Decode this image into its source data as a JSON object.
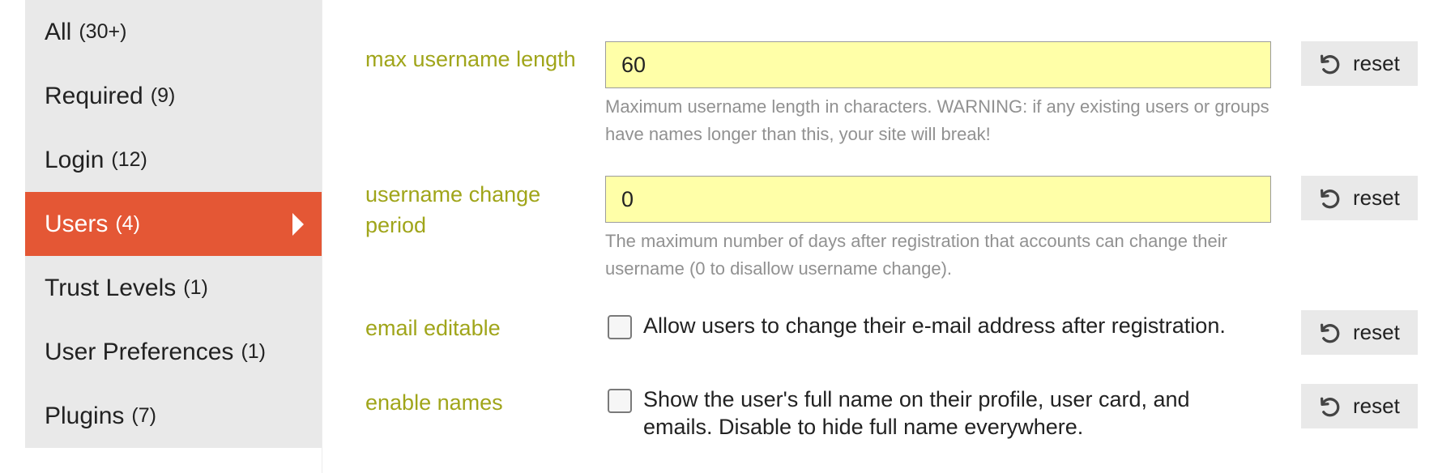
{
  "sidebar": {
    "items": [
      {
        "label": "All",
        "count": "(30+)"
      },
      {
        "label": "Required",
        "count": "(9)"
      },
      {
        "label": "Login",
        "count": "(12)"
      },
      {
        "label": "Users",
        "count": "(4)",
        "active": true
      },
      {
        "label": "Trust Levels",
        "count": "(1)"
      },
      {
        "label": "User Preferences",
        "count": "(1)"
      },
      {
        "label": "Plugins",
        "count": "(7)"
      }
    ]
  },
  "settings": [
    {
      "label": "max username length",
      "type": "text",
      "value": "60",
      "description": "Maximum username length in characters. WARNING: if any existing users or groups have names longer than this, your site will break!",
      "reset_label": "reset"
    },
    {
      "label": "username change period",
      "type": "text",
      "value": "0",
      "description": "The maximum number of days after registration that accounts can change their username (0 to disallow username change).",
      "reset_label": "reset"
    },
    {
      "label": "email editable",
      "type": "checkbox",
      "checked": false,
      "checkbox_text": "Allow users to change their e-mail address after registration.",
      "reset_label": "reset"
    },
    {
      "label": "enable names",
      "type": "checkbox",
      "checked": false,
      "checkbox_text": "Show the user's full name on their profile, user card, and emails. Disable to hide full name everywhere.",
      "reset_label": "reset"
    }
  ],
  "colors": {
    "accent": "#e45735",
    "label": "#a0a51a",
    "input_bg": "#ffffa8",
    "sidebar_bg": "#e9e9e9",
    "muted_text": "#919191"
  },
  "icons": {
    "reset": "undo-icon",
    "active_indicator": "caret-right-icon"
  }
}
